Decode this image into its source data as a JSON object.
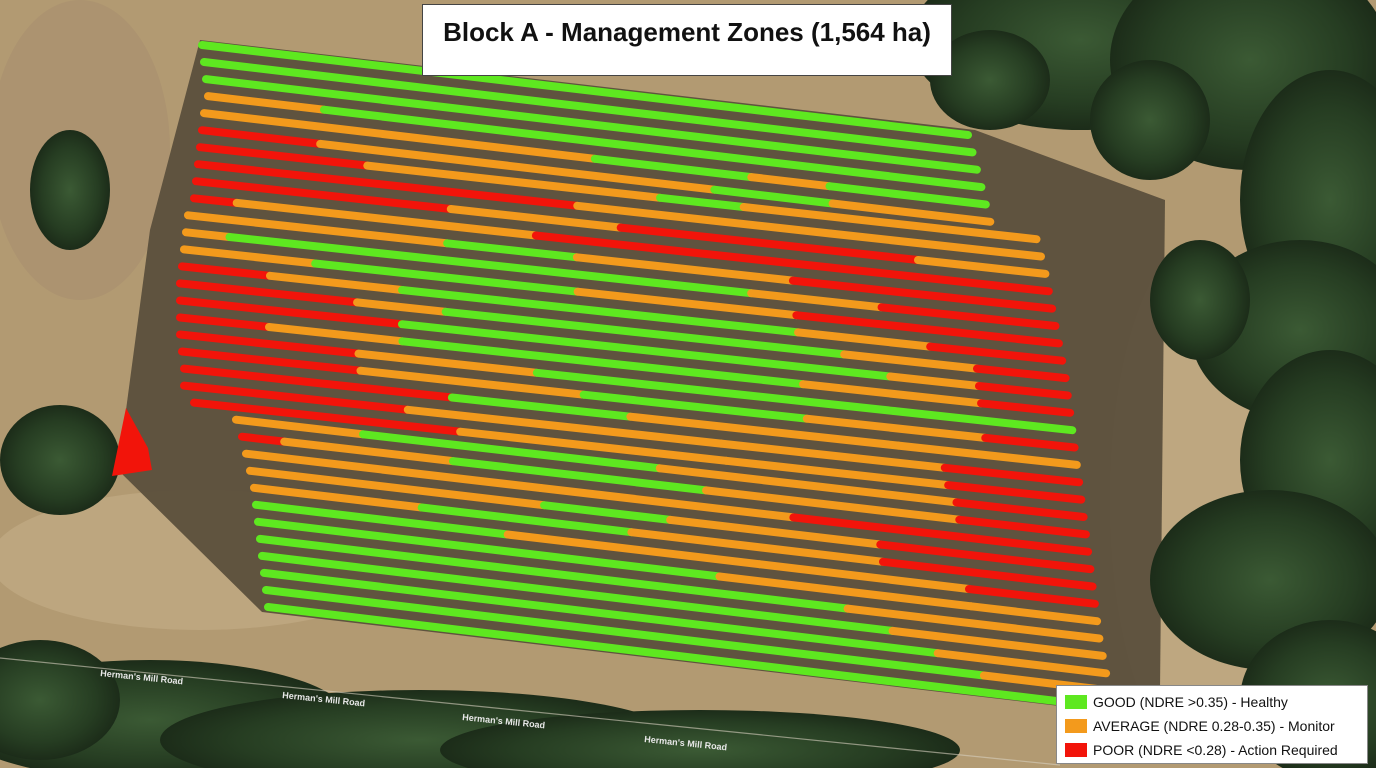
{
  "title": "Block A - Management Zones (1,564 ha)",
  "road_name": "Herman's Mill Road",
  "colors": {
    "good": "#5ee820",
    "average": "#f39a1c",
    "poor": "#f2140a",
    "soil": "#b49c74",
    "row_gap": "#5a4e3a",
    "trees": "#2f4a2c"
  },
  "legend": [
    {
      "zone": "good",
      "label": "GOOD (NDRE >0.35) - Healthy"
    },
    {
      "zone": "average",
      "label": "AVERAGE (NDRE 0.28-0.35) - Monitor"
    },
    {
      "zone": "poor",
      "label": "POOR (NDRE <0.28) - Action Required"
    }
  ],
  "rows": [
    {
      "segments": [
        [
          "good",
          1.0
        ]
      ]
    },
    {
      "segments": [
        [
          "good",
          1.0
        ]
      ]
    },
    {
      "segments": [
        [
          "good",
          1.0
        ]
      ]
    },
    {
      "segments": [
        [
          "average",
          0.15
        ],
        [
          "good",
          0.85
        ]
      ]
    },
    {
      "segments": [
        [
          "average",
          0.5
        ],
        [
          "good",
          0.2
        ],
        [
          "average",
          0.1
        ],
        [
          "good",
          0.2
        ]
      ]
    },
    {
      "segments": [
        [
          "poor",
          0.15
        ],
        [
          "average",
          0.5
        ],
        [
          "good",
          0.15
        ],
        [
          "average",
          0.2
        ]
      ]
    },
    {
      "segments": [
        [
          "poor",
          0.2
        ],
        [
          "average",
          0.35
        ],
        [
          "good",
          0.1
        ],
        [
          "average",
          0.35
        ]
      ]
    },
    {
      "segments": [
        [
          "poor",
          0.45
        ],
        [
          "average",
          0.3
        ],
        [
          "average",
          0.25
        ]
      ]
    },
    {
      "segments": [
        [
          "poor",
          0.3
        ],
        [
          "average",
          0.2
        ],
        [
          "poor",
          0.35
        ],
        [
          "average",
          0.15
        ]
      ]
    },
    {
      "segments": [
        [
          "poor",
          0.05
        ],
        [
          "average",
          0.35
        ],
        [
          "poor",
          0.55
        ],
        [
          "poor",
          0.05
        ]
      ]
    },
    {
      "segments": [
        [
          "average",
          0.3
        ],
        [
          "good",
          0.15
        ],
        [
          "average",
          0.25
        ],
        [
          "poor",
          0.3
        ]
      ]
    },
    {
      "segments": [
        [
          "average",
          0.05
        ],
        [
          "good",
          0.6
        ],
        [
          "average",
          0.15
        ],
        [
          "poor",
          0.2
        ]
      ]
    },
    {
      "segments": [
        [
          "average",
          0.15
        ],
        [
          "good",
          0.3
        ],
        [
          "average",
          0.25
        ],
        [
          "poor",
          0.3
        ]
      ]
    },
    {
      "segments": [
        [
          "poor",
          0.1
        ],
        [
          "average",
          0.15
        ],
        [
          "good",
          0.45
        ],
        [
          "average",
          0.15
        ],
        [
          "poor",
          0.15
        ]
      ]
    },
    {
      "segments": [
        [
          "poor",
          0.2
        ],
        [
          "average",
          0.1
        ],
        [
          "good",
          0.45
        ],
        [
          "average",
          0.15
        ],
        [
          "poor",
          0.1
        ]
      ]
    },
    {
      "segments": [
        [
          "poor",
          0.25
        ],
        [
          "good",
          0.55
        ],
        [
          "average",
          0.1
        ],
        [
          "poor",
          0.1
        ]
      ]
    },
    {
      "segments": [
        [
          "poor",
          0.1
        ],
        [
          "average",
          0.15
        ],
        [
          "good",
          0.45
        ],
        [
          "average",
          0.2
        ],
        [
          "poor",
          0.1
        ]
      ]
    },
    {
      "segments": [
        [
          "poor",
          0.2
        ],
        [
          "average",
          0.2
        ],
        [
          "good",
          0.4
        ],
        [
          "good",
          0.2
        ]
      ]
    },
    {
      "segments": [
        [
          "poor",
          0.2
        ],
        [
          "average",
          0.25
        ],
        [
          "good",
          0.25
        ],
        [
          "average",
          0.2
        ],
        [
          "poor",
          0.1
        ]
      ]
    },
    {
      "segments": [
        [
          "poor",
          0.3
        ],
        [
          "good",
          0.2
        ],
        [
          "average",
          0.3
        ],
        [
          "average",
          0.2
        ]
      ]
    },
    {
      "segments": [
        [
          "poor",
          0.25
        ],
        [
          "average",
          0.35
        ],
        [
          "average",
          0.25
        ],
        [
          "poor",
          0.15
        ]
      ]
    },
    {
      "segments": [
        [
          "poor",
          0.3
        ],
        [
          "average",
          0.3
        ],
        [
          "average",
          0.25
        ],
        [
          "poor",
          0.15
        ]
      ]
    },
    {
      "segments": [
        [
          "average",
          0.15
        ],
        [
          "good",
          0.35
        ],
        [
          "average",
          0.35
        ],
        [
          "poor",
          0.15
        ]
      ]
    },
    {
      "segments": [
        [
          "poor",
          0.05
        ],
        [
          "average",
          0.2
        ],
        [
          "good",
          0.3
        ],
        [
          "average",
          0.3
        ],
        [
          "poor",
          0.15
        ]
      ]
    },
    {
      "segments": [
        [
          "average",
          0.35
        ],
        [
          "average",
          0.3
        ],
        [
          "poor",
          0.35
        ]
      ]
    },
    {
      "segments": [
        [
          "average",
          0.35
        ],
        [
          "good",
          0.15
        ],
        [
          "average",
          0.25
        ],
        [
          "poor",
          0.25
        ]
      ]
    },
    {
      "segments": [
        [
          "average",
          0.2
        ],
        [
          "good",
          0.25
        ],
        [
          "average",
          0.3
        ],
        [
          "poor",
          0.25
        ]
      ]
    },
    {
      "segments": [
        [
          "good",
          0.3
        ],
        [
          "average",
          0.3
        ],
        [
          "average",
          0.25
        ],
        [
          "poor",
          0.15
        ]
      ]
    },
    {
      "segments": [
        [
          "good",
          0.55
        ],
        [
          "average",
          0.3
        ],
        [
          "average",
          0.15
        ]
      ]
    },
    {
      "segments": [
        [
          "good",
          0.5
        ],
        [
          "good",
          0.2
        ],
        [
          "average",
          0.3
        ]
      ]
    },
    {
      "segments": [
        [
          "good",
          0.75
        ],
        [
          "average",
          0.25
        ]
      ]
    },
    {
      "segments": [
        [
          "good",
          0.8
        ],
        [
          "average",
          0.2
        ]
      ]
    },
    {
      "segments": [
        [
          "good",
          0.85
        ],
        [
          "average",
          0.15
        ]
      ]
    },
    {
      "segments": [
        [
          "good",
          1.0
        ]
      ]
    }
  ]
}
